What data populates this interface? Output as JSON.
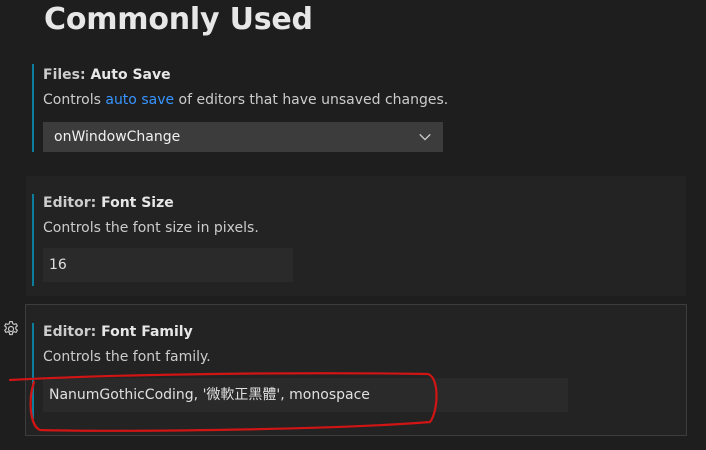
{
  "page": {
    "title": "Commonly Used"
  },
  "settings": [
    {
      "category": "Files: ",
      "name": "Auto Save",
      "description_before": "Controls ",
      "description_link": "auto save",
      "description_after": " of editors that have unsaved changes.",
      "value": "onWindowChange",
      "control": "select",
      "modified": true
    },
    {
      "category": "Editor: ",
      "name": "Font Size",
      "description": "Controls the font size in pixels.",
      "value": "16",
      "control": "number-input",
      "modified": true
    },
    {
      "category": "Editor: ",
      "name": "Font Family",
      "description": "Controls the font family.",
      "value": "NanumGothicCoding, '微軟正黑體', monospace",
      "control": "text-input",
      "modified": true
    }
  ],
  "icons": {
    "settings_gear": "gear-icon",
    "dropdown": "chevron-down-icon"
  },
  "colors": {
    "background": "#1e1e1e",
    "modified_indicator": "#0c7d9d",
    "link": "#3794ff",
    "annotation": "#d11414"
  }
}
